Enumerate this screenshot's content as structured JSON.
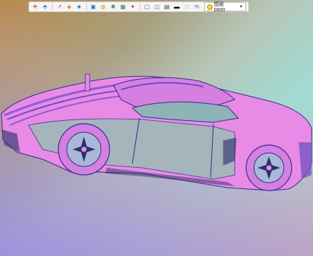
{
  "toolbar": {
    "layer_label": "图层0000",
    "icons": [
      "snap-icon",
      "select-icon",
      "move-icon",
      "paint-icon",
      "cube-icon",
      "view-icon",
      "render-icon",
      "light-icon",
      "grid-icon",
      "section-icon",
      "camera-icon",
      "color-swatch-icon",
      "frame-icon",
      "layer-icon"
    ]
  },
  "colors": {
    "car_body": "#e88ae6",
    "car_body_shade": "#c86fd0",
    "car_glass": "#9bc6c2",
    "edge_line": "#2b2f8a",
    "wheel_dark": "#2a2f66",
    "toolbar_bg": "#f4f4f4"
  }
}
